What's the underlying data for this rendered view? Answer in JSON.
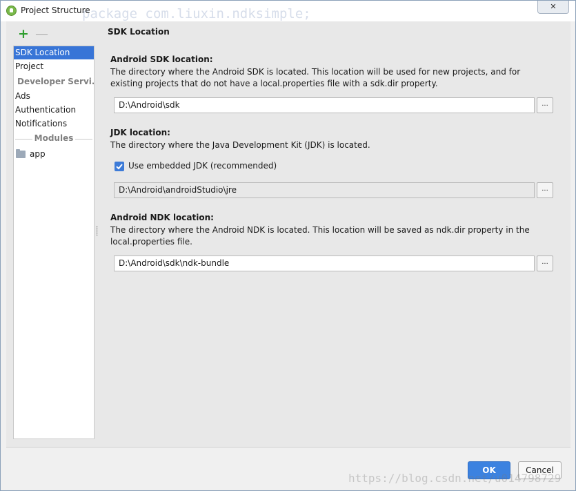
{
  "window": {
    "title": "Project Structure",
    "close_glyph": "✕",
    "background_code": "package com.liuxin.ndksimple;"
  },
  "toolbar": {
    "add_glyph": "+",
    "remove_glyph": "—"
  },
  "sidebar": {
    "items": [
      {
        "label": "SDK Location",
        "selected": true
      },
      {
        "label": "Project"
      }
    ],
    "developer_services_header": "Developer Servi...",
    "developer_services": [
      {
        "label": "Ads"
      },
      {
        "label": "Authentication"
      },
      {
        "label": "Notifications"
      }
    ],
    "modules_header": "Modules",
    "modules": [
      {
        "label": "app",
        "icon": "folder-icon"
      }
    ]
  },
  "main": {
    "section_title": "SDK Location",
    "sdk": {
      "label": "Android SDK location:",
      "description": "The directory where the Android SDK is located. This location will be used for new projects, and for existing projects that do not have a local.properties file with a sdk.dir property.",
      "path": "D:\\Android\\sdk"
    },
    "jdk": {
      "label": "JDK location:",
      "description": "The directory where the Java Development Kit (JDK) is located.",
      "checkbox_label": "Use embedded JDK (recommended)",
      "checked": true,
      "path": "D:\\Android\\androidStudio\\jre"
    },
    "ndk": {
      "label": "Android NDK location:",
      "description": "The directory where the Android NDK is located. This location will be saved as ndk.dir property in the local.properties file.",
      "path": "D:\\Android\\sdk\\ndk-bundle"
    },
    "browse_label": "..."
  },
  "footer": {
    "ok_label": "OK",
    "cancel_label": "Cancel"
  },
  "watermark": "https://blog.csdn.net/u014798729",
  "colors": {
    "selection": "#3875d7",
    "ok_button": "#3c82e0",
    "add_green": "#2f9e2f"
  }
}
